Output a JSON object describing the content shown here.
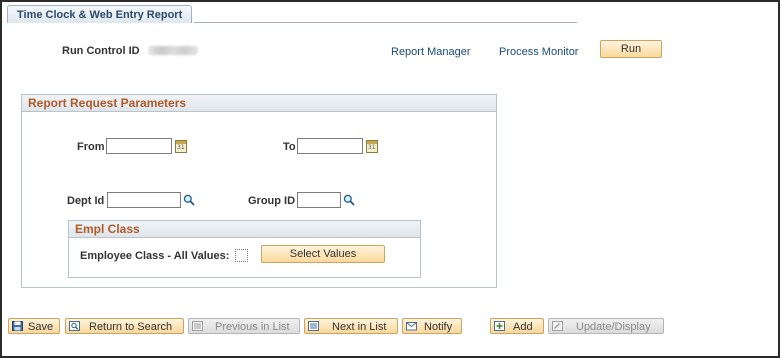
{
  "page": {
    "tab_title": "Time Clock & Web Entry Report",
    "run_control_label": "Run Control ID",
    "report_manager": "Report Manager",
    "process_monitor": "Process Monitor",
    "run_button": "Run"
  },
  "params": {
    "header": "Report Request Parameters",
    "from_label": "From",
    "from_value": "",
    "to_label": "To",
    "to_value": "",
    "dept_label": "Dept Id",
    "dept_value": "",
    "group_label": "Group ID",
    "group_value": "",
    "empl_class": {
      "header": "Empl Class",
      "all_values_label": "Employee Class - All Values:",
      "all_values_checked": false,
      "select_values_button": "Select Values"
    },
    "calendar_glyph": "31"
  },
  "toolbar": {
    "save": "Save",
    "return_to_search": "Return to Search",
    "previous_in_list": "Previous in List",
    "next_in_list": "Next in List",
    "notify": "Notify",
    "add": "Add",
    "update_display": "Update/Display"
  },
  "colors": {
    "section_header_text": "#b05a2a",
    "link": "#1b4a7a",
    "button_fill": "#f9d79b"
  }
}
